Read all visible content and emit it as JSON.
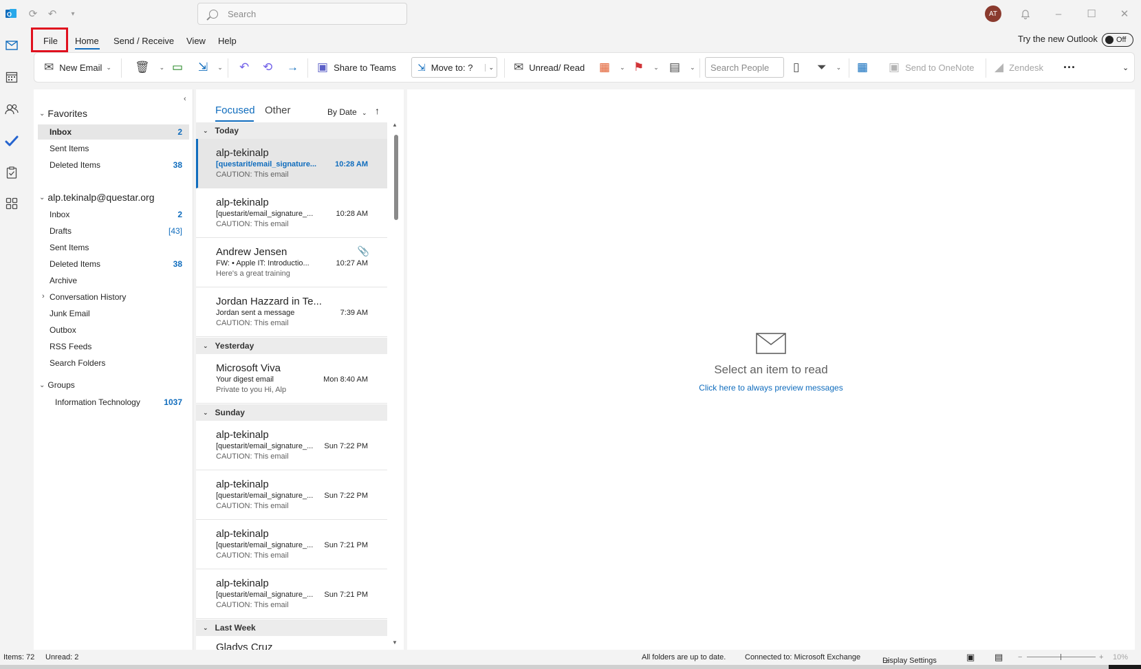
{
  "titlebar": {
    "search_placeholder": "Search",
    "avatar_initials": "AT"
  },
  "ribbon_tabs": [
    "File",
    "Home",
    "Send / Receive",
    "View",
    "Help"
  ],
  "try_new": {
    "label": "Try the new Outlook",
    "toggle": "Off"
  },
  "ribbon": {
    "new_email": "New Email",
    "share_teams": "Share to Teams",
    "move_to": "Move to: ?",
    "unread_read": "Unread/ Read",
    "search_people_placeholder": "Search People",
    "send_onenote": "Send to OneNote",
    "zendesk": "Zendesk",
    "more": "···"
  },
  "folders": {
    "favorites_label": "Favorites",
    "favorites": [
      {
        "label": "Inbox",
        "count": "2"
      },
      {
        "label": "Sent Items",
        "count": ""
      },
      {
        "label": "Deleted Items",
        "count": "38"
      }
    ],
    "account_label": "alp.tekinalp@questar.org",
    "account": [
      {
        "label": "Inbox",
        "count": "2"
      },
      {
        "label": "Drafts",
        "count": "[43]"
      },
      {
        "label": "Sent Items",
        "count": ""
      },
      {
        "label": "Deleted Items",
        "count": "38"
      },
      {
        "label": "Archive",
        "count": ""
      },
      {
        "label": "Conversation History",
        "count": ""
      },
      {
        "label": "Junk Email",
        "count": ""
      },
      {
        "label": "Outbox",
        "count": ""
      },
      {
        "label": "RSS Feeds",
        "count": ""
      },
      {
        "label": "Search Folders",
        "count": ""
      }
    ],
    "groups_label": "Groups",
    "groups": [
      {
        "label": "Information Technology",
        "count": "1037"
      }
    ]
  },
  "message_list": {
    "tab_focused": "Focused",
    "tab_other": "Other",
    "sort": "By Date",
    "groups": [
      "Today",
      "Yesterday",
      "Sunday",
      "Last Week"
    ],
    "mails": [
      {
        "sender": "alp-tekinalp",
        "subject": "[questarit/email_signature...",
        "time": "10:28 AM",
        "preview": "CAUTION: This email"
      },
      {
        "sender": "alp-tekinalp",
        "subject": "[questarit/email_signature_...",
        "time": "10:28 AM",
        "preview": "CAUTION: This email"
      },
      {
        "sender": "Andrew Jensen",
        "subject": "FW: • Apple IT: Introductio...",
        "time": "10:27 AM",
        "preview": "Here's a great training"
      },
      {
        "sender": "Jordan Hazzard in Te...",
        "subject": "Jordan sent a message",
        "time": "7:39 AM",
        "preview": "CAUTION: This email"
      },
      {
        "sender": "Microsoft Viva",
        "subject": "Your digest email",
        "time": "Mon 8:40 AM",
        "preview": "Private to you  Hi, Alp"
      },
      {
        "sender": "alp-tekinalp",
        "subject": "[questarit/email_signature_...",
        "time": "Sun 7:22 PM",
        "preview": "CAUTION: This email"
      },
      {
        "sender": "alp-tekinalp",
        "subject": "[questarit/email_signature_...",
        "time": "Sun 7:22 PM",
        "preview": "CAUTION: This email"
      },
      {
        "sender": "alp-tekinalp",
        "subject": "[questarit/email_signature_...",
        "time": "Sun 7:21 PM",
        "preview": "CAUTION: This email"
      },
      {
        "sender": "alp-tekinalp",
        "subject": "[questarit/email_signature_...",
        "time": "Sun 7:21 PM",
        "preview": "CAUTION: This email"
      },
      {
        "sender": "Gladys Cruz",
        "subject": "",
        "time": "",
        "preview": ""
      }
    ]
  },
  "reading_pane": {
    "title": "Select an item to read",
    "link": "Click here to always preview messages"
  },
  "statusbar": {
    "items": "Items: 72",
    "unread": "Unread: 2",
    "sync": "All folders are up to date.",
    "connected": "Connected to: Microsoft Exchange",
    "display_settings": "Display Settings",
    "zoom": "10%"
  },
  "colors": {
    "accent": "#0f6cbd",
    "highlight": "#e0101e"
  }
}
